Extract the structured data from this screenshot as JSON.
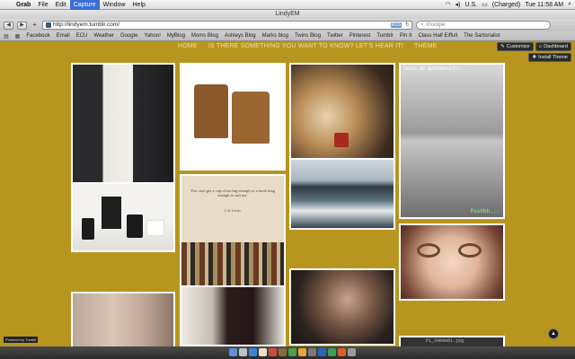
{
  "menubar": {
    "items": [
      "Grab",
      "File",
      "Edit",
      "Capture",
      "Window",
      "Help"
    ],
    "active_index": 3,
    "status": {
      "flag": "U.S.",
      "battery": "(Charged)",
      "clock": "Tue 11:58 AM"
    }
  },
  "window": {
    "title": "LindyEM"
  },
  "toolbar": {
    "url": "http://lindyem.tumblr.com/",
    "rss_label": "RSS",
    "search_placeholder": "Google"
  },
  "bookmarks": [
    "Facebook",
    "Email",
    "ECU",
    "Weather",
    "Google",
    "Yahoo!",
    "MyBlog",
    "Moms Blog",
    "Ashleys Blog",
    "Marks blog",
    "Twins Blog",
    "Twitter",
    "Pinterest",
    "Tumblr",
    "Pin It",
    "Class Half Eiffull",
    "The Sartorialist"
  ],
  "page": {
    "nav": [
      "HOME",
      "IS THERE SOMETHING YOU WANT TO KNOW? LET'S HEAR IT!",
      "THEME"
    ],
    "customize_label": "Customize",
    "dashboard_label": "Dashboard",
    "install_label": "Install Theme",
    "quote_text": "You can't get a cup of tea big enough or a book long enough to suit me.",
    "quote_author": "C.S. Lewis",
    "twins_caption": "TWINS OR QUADRUPLETS?...",
    "twins_footer": "Psshhh...",
    "powered_label": "Powered by Tumblr",
    "scroll_icon": "scroll-top-icon",
    "file_label": "P1_34N4eR1.jpg"
  },
  "colors": {
    "page_bg": "#b8951e",
    "nav_text": "#ede0a8",
    "menu_active": "#3b6fd6"
  }
}
